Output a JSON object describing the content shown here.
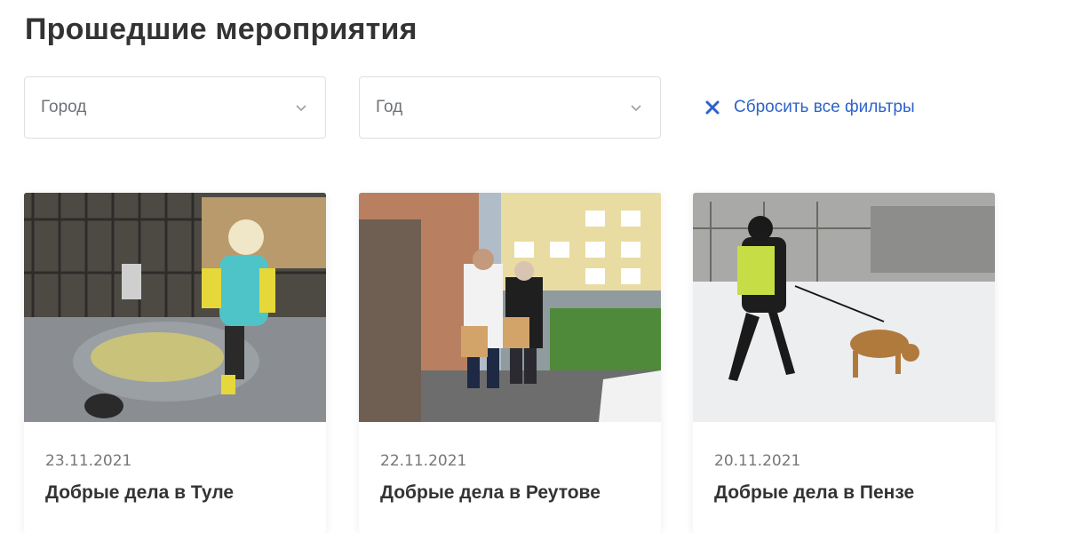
{
  "page": {
    "title": "Прошедшие мероприятия"
  },
  "filters": {
    "city_placeholder": "Город",
    "year_placeholder": "Год",
    "reset_label": "Сбросить все фильтры",
    "accent_color": "#2d63c8"
  },
  "events": [
    {
      "date": "23.11.2021",
      "title": "Добрые дела в Туле"
    },
    {
      "date": "22.11.2021",
      "title": "Добрые дела в Реутове"
    },
    {
      "date": "20.11.2021",
      "title": "Добрые дела в Пензе"
    }
  ]
}
